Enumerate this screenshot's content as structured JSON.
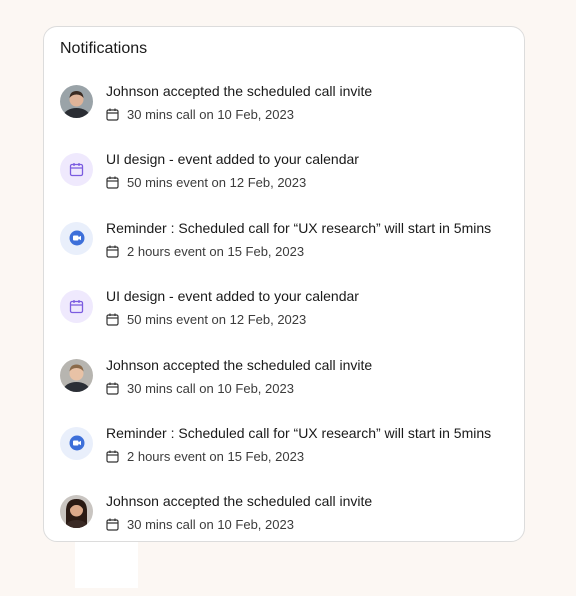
{
  "panel": {
    "title": "Notifications"
  },
  "notifications": [
    {
      "avatar": "person-avatar",
      "title": "Johnson accepted the scheduled call invite",
      "meta": "30 mins call on 10 Feb, 2023"
    },
    {
      "avatar": "calendar-icon",
      "title": "UI design - event added to your calendar",
      "meta": "50 mins event on 12 Feb, 2023"
    },
    {
      "avatar": "video-call-icon",
      "title": "Reminder : Scheduled call for “UX research” will start in 5mins",
      "meta": "2 hours event on 15 Feb, 2023"
    },
    {
      "avatar": "calendar-icon",
      "title": "UI design - event added to your calendar",
      "meta": "50 mins event on 12 Feb, 2023"
    },
    {
      "avatar": "person-avatar",
      "title": "Johnson accepted the scheduled call invite",
      "meta": "30 mins call on 10 Feb, 2023"
    },
    {
      "avatar": "video-call-icon",
      "title": "Reminder : Scheduled call for “UX research” will start in 5mins",
      "meta": "2 hours event on 15 Feb, 2023"
    },
    {
      "avatar": "person-avatar",
      "title": "Johnson accepted the scheduled call invite",
      "meta": "30 mins call on 10 Feb, 2023"
    }
  ],
  "colors": {
    "calendar_accent": "#7b5ce0",
    "video_accent": "#3d6fd9"
  }
}
